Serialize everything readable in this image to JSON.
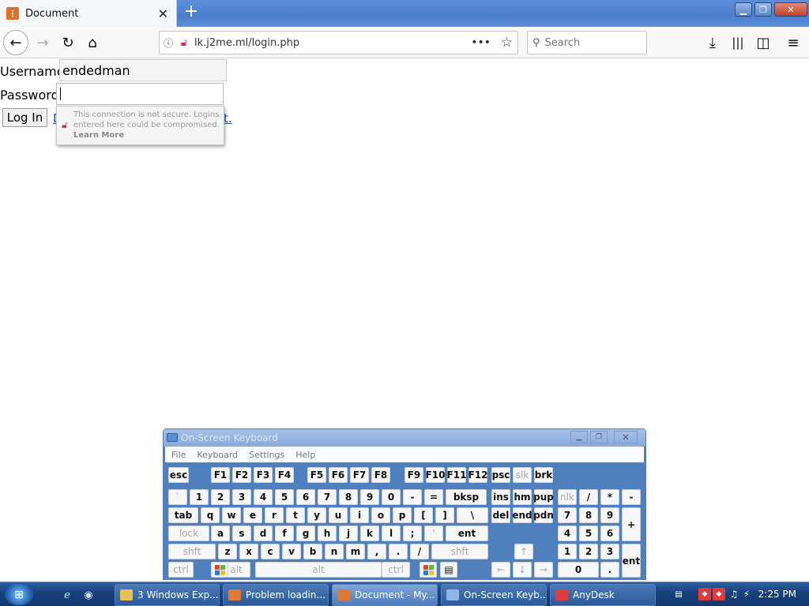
{
  "browser": {
    "tab_title": "Document",
    "url": "lk.j2me.ml/login.php",
    "search_placeholder": "Search",
    "tab_favicon": "firefox-page-icon"
  },
  "page": {
    "username_label": "Username",
    "username_value": "endedman",
    "password_label": "Password",
    "login_button": "Log In",
    "hidden_link_start": "D",
    "hidden_link_end": "t.",
    "popup_text": "This connection is not secure. Logins entered here could be compromised.",
    "popup_link": "Learn More"
  },
  "osk": {
    "title": "On-Screen Keyboard",
    "menu": [
      "File",
      "Keyboard",
      "Settings",
      "Help"
    ],
    "rows": {
      "r1": [
        "esc",
        "F1",
        "F2",
        "F3",
        "F4",
        "F5",
        "F6",
        "F7",
        "F8",
        "F9",
        "F10",
        "F11",
        "F12",
        "psc",
        "slk",
        "brk"
      ],
      "r2": [
        "`",
        "1",
        "2",
        "3",
        "4",
        "5",
        "6",
        "7",
        "8",
        "9",
        "0",
        "-",
        "=",
        "bksp",
        "ins",
        "hm",
        "pup",
        "nlk",
        "/",
        "*",
        "-"
      ],
      "r3": [
        "tab",
        "q",
        "w",
        "e",
        "r",
        "t",
        "y",
        "u",
        "i",
        "o",
        "p",
        "[",
        "]",
        "\\",
        "del",
        "end",
        "pdn",
        "7",
        "8",
        "9",
        "+"
      ],
      "r4": [
        "lock",
        "a",
        "s",
        "d",
        "f",
        "g",
        "h",
        "j",
        "k",
        "l",
        ";",
        "'",
        "ent",
        "4",
        "5",
        "6"
      ],
      "r5": [
        "shft",
        "z",
        "x",
        "c",
        "v",
        "b",
        "n",
        "m",
        ",",
        ".",
        "/",
        "shft",
        "↑",
        "1",
        "2",
        "3",
        "ent"
      ],
      "r6": [
        "ctrl",
        "alt",
        "alt",
        "ctrl",
        "←",
        "↓",
        "→",
        "0",
        "."
      ]
    }
  },
  "taskbar": {
    "items": [
      "3 Windows Exp...",
      "Problem loadin...",
      "Document - My...",
      "On-Screen Keyb...",
      "AnyDesk"
    ],
    "clock": "2:25 PM"
  },
  "colors": {
    "tabstrip": "#4b7fcf",
    "taskbar": "#163f78",
    "osk": "#4f7fbd"
  }
}
